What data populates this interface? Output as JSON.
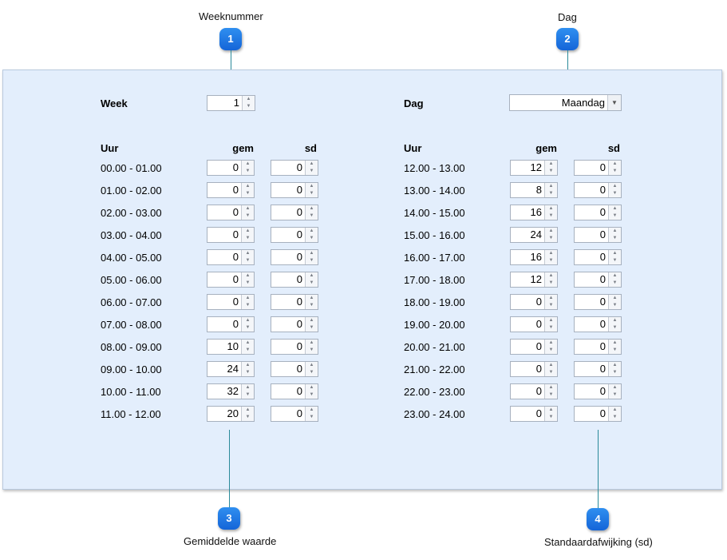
{
  "callouts": {
    "c1": {
      "number": "1",
      "label": "Weeknummer"
    },
    "c2": {
      "number": "2",
      "label": "Dag"
    },
    "c3": {
      "number": "3",
      "label": "Gemiddelde waarde"
    },
    "c4": {
      "number": "4",
      "label": "Standaardafwijking (sd)"
    }
  },
  "form": {
    "week_label": "Week",
    "week_value": "1",
    "dag_label": "Dag",
    "dag_value": "Maandag",
    "hour_header": "Uur",
    "gem_header": "gem",
    "sd_header": "sd"
  },
  "left_rows": [
    {
      "hour": "00.00 - 01.00",
      "gem": "0",
      "sd": "0"
    },
    {
      "hour": "01.00 - 02.00",
      "gem": "0",
      "sd": "0"
    },
    {
      "hour": "02.00 - 03.00",
      "gem": "0",
      "sd": "0"
    },
    {
      "hour": "03.00 - 04.00",
      "gem": "0",
      "sd": "0"
    },
    {
      "hour": "04.00 - 05.00",
      "gem": "0",
      "sd": "0"
    },
    {
      "hour": "05.00 - 06.00",
      "gem": "0",
      "sd": "0"
    },
    {
      "hour": "06.00 - 07.00",
      "gem": "0",
      "sd": "0"
    },
    {
      "hour": "07.00 - 08.00",
      "gem": "0",
      "sd": "0"
    },
    {
      "hour": "08.00 - 09.00",
      "gem": "10",
      "sd": "0"
    },
    {
      "hour": "09.00 - 10.00",
      "gem": "24",
      "sd": "0"
    },
    {
      "hour": "10.00 - 11.00",
      "gem": "32",
      "sd": "0"
    },
    {
      "hour": "11.00 - 12.00",
      "gem": "20",
      "sd": "0"
    }
  ],
  "right_rows": [
    {
      "hour": "12.00 - 13.00",
      "gem": "12",
      "sd": "0"
    },
    {
      "hour": "13.00 - 14.00",
      "gem": "8",
      "sd": "0"
    },
    {
      "hour": "14.00 - 15.00",
      "gem": "16",
      "sd": "0"
    },
    {
      "hour": "15.00 - 16.00",
      "gem": "24",
      "sd": "0"
    },
    {
      "hour": "16.00 - 17.00",
      "gem": "16",
      "sd": "0"
    },
    {
      "hour": "17.00 - 18.00",
      "gem": "12",
      "sd": "0"
    },
    {
      "hour": "18.00 - 19.00",
      "gem": "0",
      "sd": "0"
    },
    {
      "hour": "19.00 - 20.00",
      "gem": "0",
      "sd": "0"
    },
    {
      "hour": "20.00 - 21.00",
      "gem": "0",
      "sd": "0"
    },
    {
      "hour": "21.00 - 22.00",
      "gem": "0",
      "sd": "0"
    },
    {
      "hour": "22.00 - 23.00",
      "gem": "0",
      "sd": "0"
    },
    {
      "hour": "23.00 - 24.00",
      "gem": "0",
      "sd": "0"
    }
  ],
  "colors": {
    "panel_bg": "#e3eefc",
    "bubble": "#1f7ae8",
    "callout_line": "#2a8a9a"
  }
}
